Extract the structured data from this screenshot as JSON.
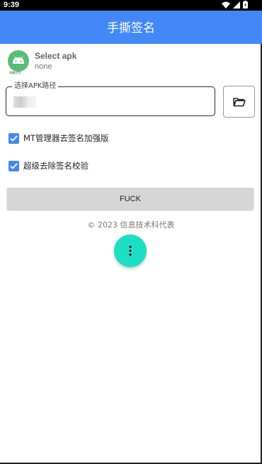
{
  "status_bar": {
    "time": "9:39"
  },
  "app_bar": {
    "title": "手撕签名"
  },
  "apk": {
    "icon": "android-app-icon",
    "icon_caption": "隐藏应用",
    "title": "Select apk",
    "subtitle": "none"
  },
  "path_field": {
    "legend": "选择APK路径",
    "value": ""
  },
  "browse_button": {
    "icon": "folder-open-icon"
  },
  "options": [
    {
      "label": "MT管理器去签名加强版",
      "checked": true
    },
    {
      "label": "超级去除签名校验",
      "checked": true
    }
  ],
  "action_button": {
    "label": "FUCK"
  },
  "footer": {
    "copyright": "© 2023 信息技术科代表"
  },
  "fab": {
    "icon": "more-vertical-icon"
  },
  "colors": {
    "primary": "#4388f8",
    "fab": "#1ddfc4",
    "button": "#d6d6d6"
  }
}
